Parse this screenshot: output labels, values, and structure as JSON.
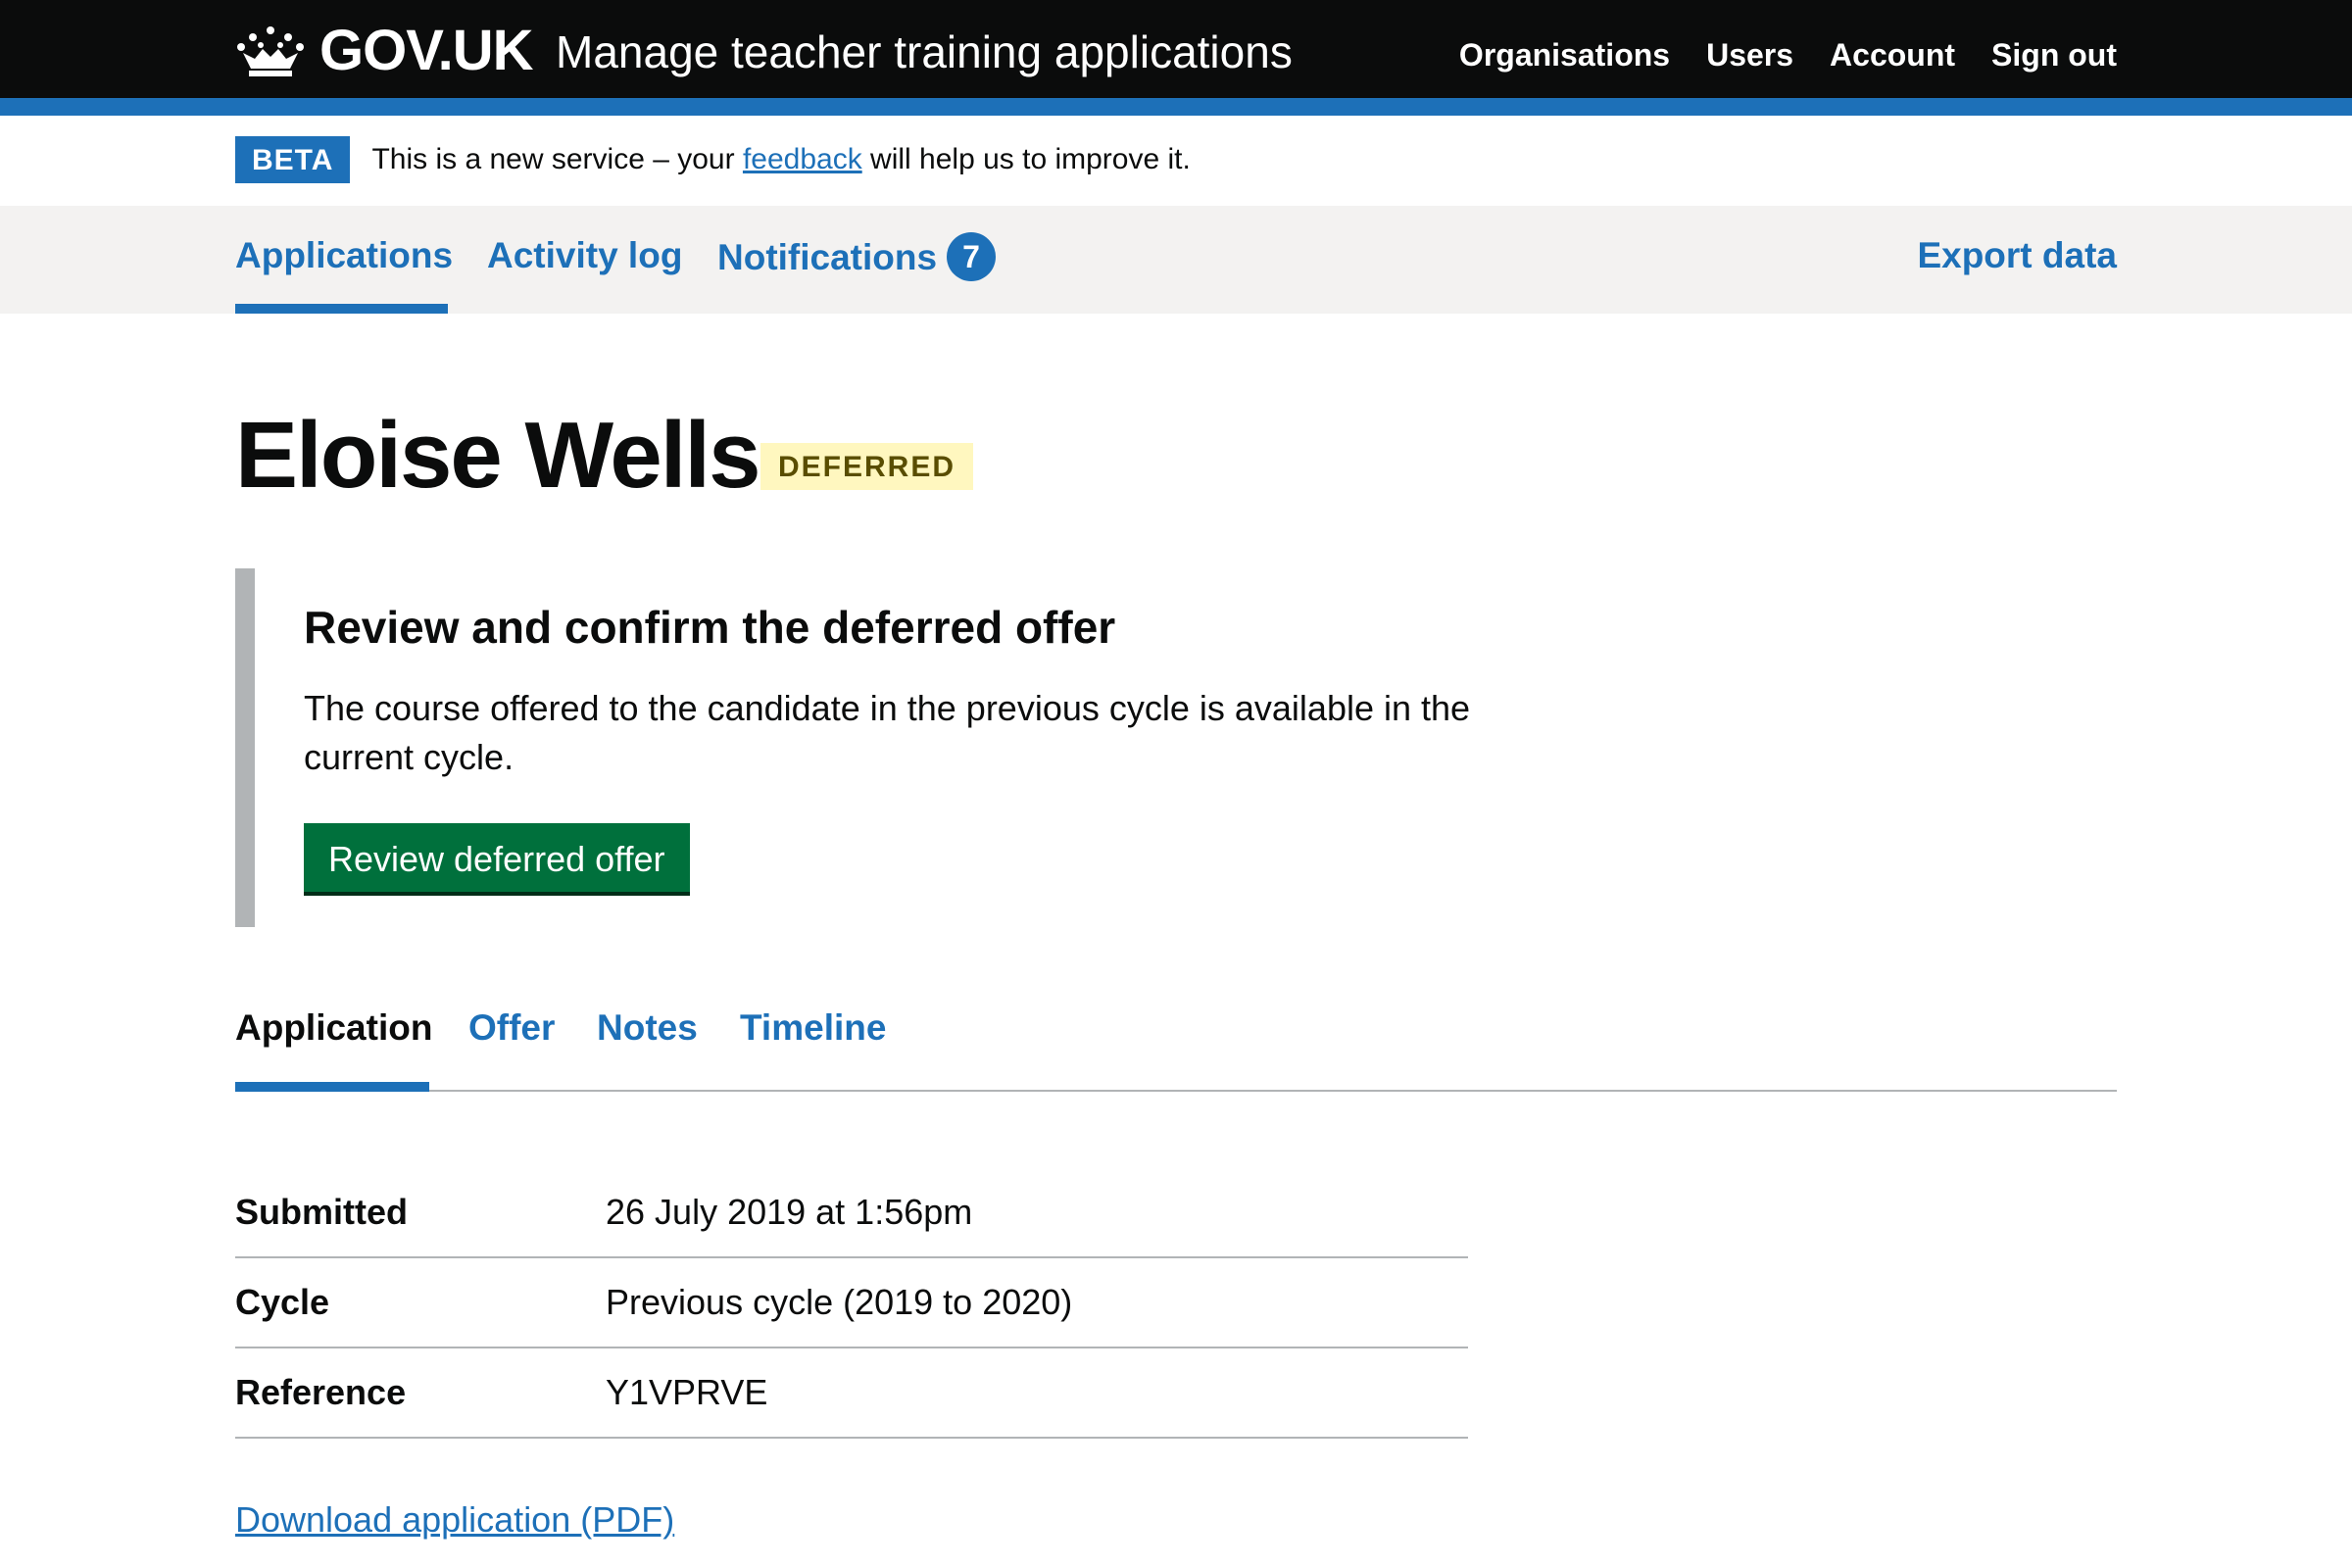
{
  "header": {
    "logo_text": "GOV.UK",
    "service_name": "Manage teacher training applications",
    "nav": [
      "Organisations",
      "Users",
      "Account",
      "Sign out"
    ]
  },
  "phase": {
    "tag": "BETA",
    "text_before": "This is a new service – your ",
    "link": "feedback",
    "text_after": " will help us to improve it."
  },
  "subnav": {
    "applications": "Applications",
    "activity_log": "Activity log",
    "notifications": "Notifications",
    "notifications_count": "7",
    "export": "Export data"
  },
  "main": {
    "title": "Eloise Wells",
    "status": "DEFERRED",
    "inset": {
      "heading": "Review and confirm the deferred offer",
      "body": "The course offered to the candidate in the previous cycle is available in the current cycle.",
      "button": "Review deferred offer"
    },
    "tabs": [
      "Application",
      "Offer",
      "Notes",
      "Timeline"
    ],
    "summary": [
      {
        "key": "Submitted",
        "value": "26 July 2019 at 1:56pm"
      },
      {
        "key": "Cycle",
        "value": "Previous cycle (2019 to 2020)"
      },
      {
        "key": "Reference",
        "value": "Y1VPRVE"
      }
    ],
    "download_link": "Download application (PDF)"
  },
  "colors": {
    "header_bg": "#0b0c0c",
    "brand_blue": "#1d70b8",
    "button_green": "#00703c",
    "tag_yellow": "#fff7bf"
  },
  "icons": [
    "crown-icon"
  ]
}
